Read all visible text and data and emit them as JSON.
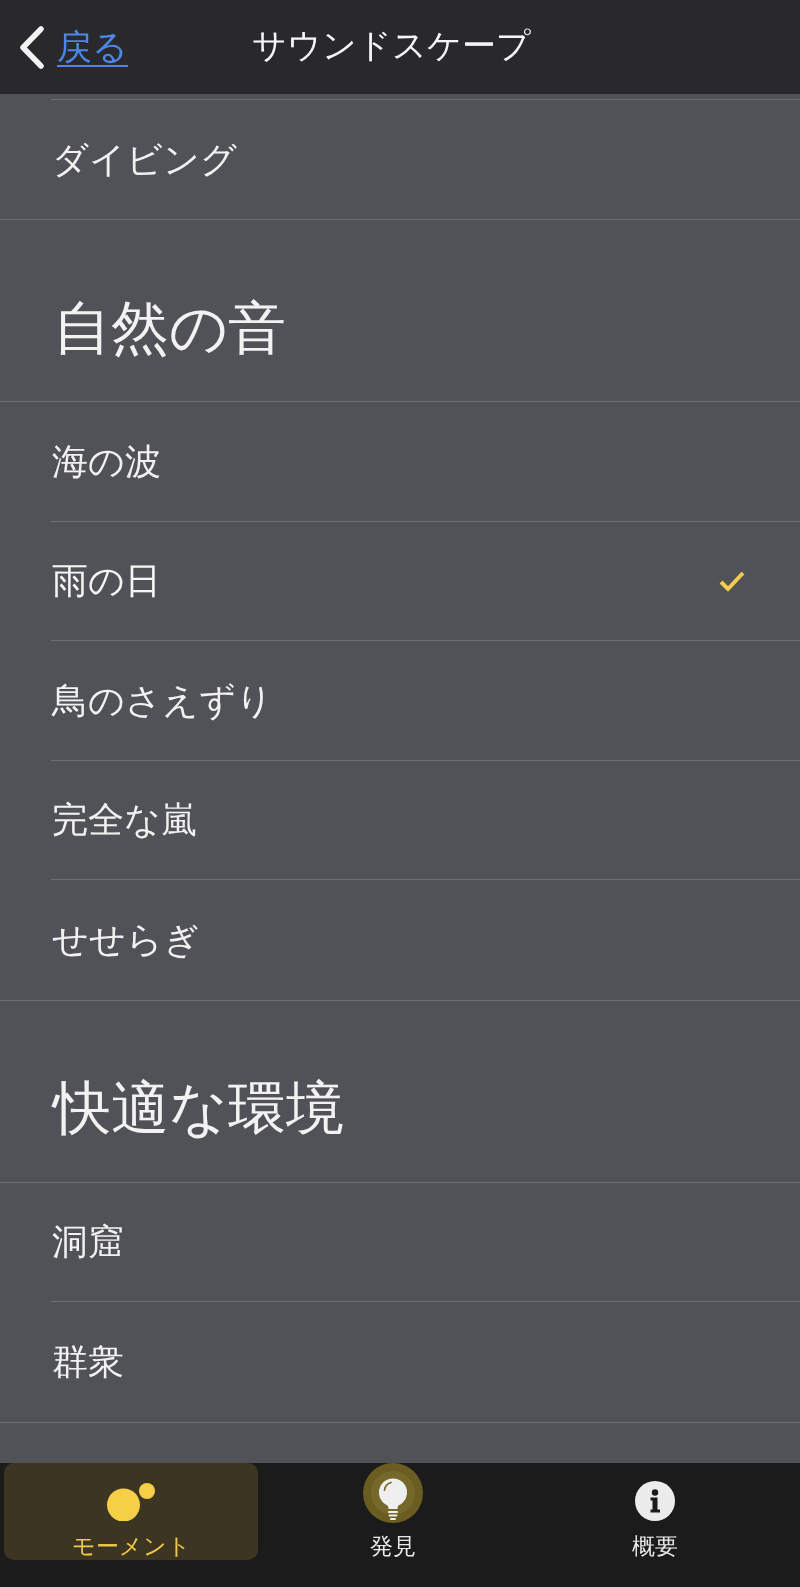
{
  "nav_bar": {
    "back_label": "戻る",
    "title": "サウンドスケープ"
  },
  "sections": [
    {
      "items": [
        {
          "label": "ダイビング",
          "selected": false
        }
      ]
    },
    {
      "title": "自然の音",
      "items": [
        {
          "label": "海の波",
          "selected": false
        },
        {
          "label": "雨の日",
          "selected": true
        },
        {
          "label": "鳥のさえずり",
          "selected": false
        },
        {
          "label": "完全な嵐",
          "selected": false
        },
        {
          "label": "せせらぎ",
          "selected": false
        }
      ]
    },
    {
      "title": "快適な環境",
      "items": [
        {
          "label": "洞窟",
          "selected": false
        },
        {
          "label": "群衆",
          "selected": false
        }
      ]
    }
  ],
  "tab_bar": {
    "tabs": [
      {
        "label": "モーメント",
        "selected": true
      },
      {
        "label": "発見",
        "selected": false
      },
      {
        "label": "概要",
        "selected": false
      }
    ]
  }
}
